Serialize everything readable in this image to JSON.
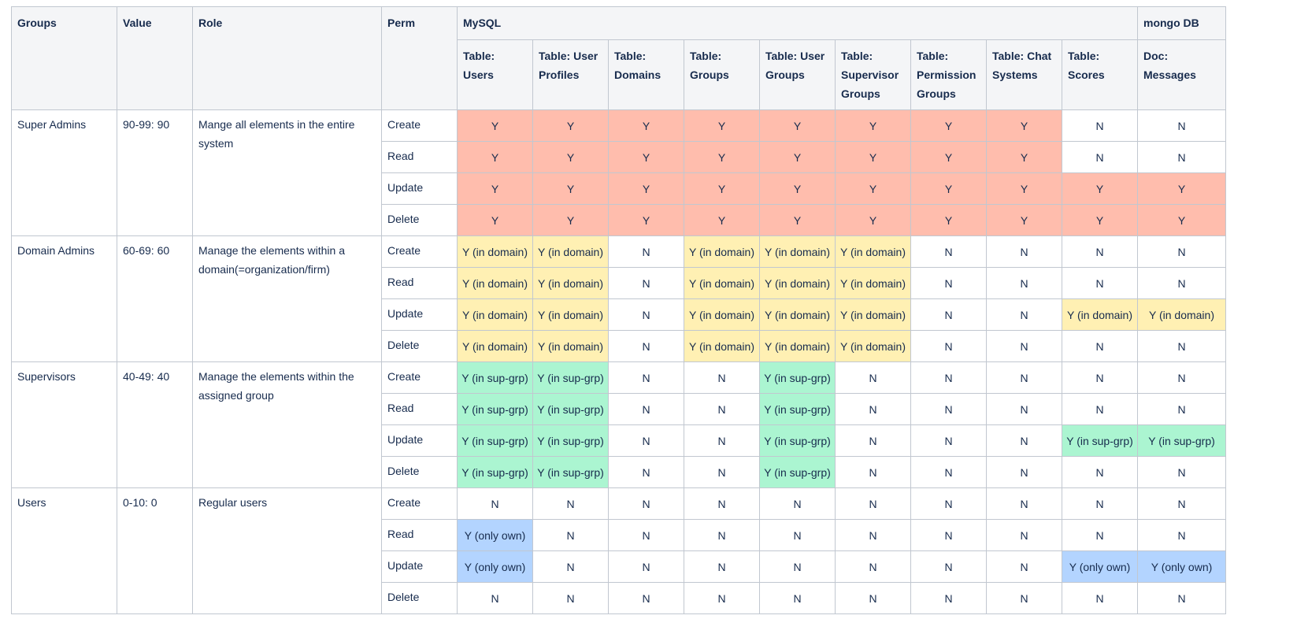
{
  "colors": {
    "red": "#ffbdad",
    "yellow": "#fff0b3",
    "green": "#abf5d1",
    "blue": "#b3d4ff",
    "none": "#ffffff"
  },
  "headers": {
    "groups": "Groups",
    "value": "Value",
    "role": "Role",
    "perm": "Perm",
    "mysql": "MySQL",
    "mongo": "mongo DB",
    "tables": [
      "Table: Users",
      "Table: User Profiles",
      "Table: Domains",
      "Table: Groups",
      "Table: User Groups",
      "Table: Supervisor Groups",
      "Table: Permission Groups",
      "Table: Chat Systems",
      "Table: Scores",
      "Doc: Messages"
    ]
  },
  "groups": [
    {
      "name": "Super Admins",
      "value": "90-99: 90",
      "role": "Mange all elements in the entire system",
      "rows": [
        {
          "perm": "Create",
          "cells": [
            "Y",
            "Y",
            "Y",
            "Y",
            "Y",
            "Y",
            "Y",
            "Y",
            "N",
            "N"
          ],
          "colors": [
            "red",
            "red",
            "red",
            "red",
            "red",
            "red",
            "red",
            "red",
            "none",
            "none"
          ]
        },
        {
          "perm": "Read",
          "cells": [
            "Y",
            "Y",
            "Y",
            "Y",
            "Y",
            "Y",
            "Y",
            "Y",
            "N",
            "N"
          ],
          "colors": [
            "red",
            "red",
            "red",
            "red",
            "red",
            "red",
            "red",
            "red",
            "none",
            "none"
          ]
        },
        {
          "perm": "Update",
          "cells": [
            "Y",
            "Y",
            "Y",
            "Y",
            "Y",
            "Y",
            "Y",
            "Y",
            "Y",
            "Y"
          ],
          "colors": [
            "red",
            "red",
            "red",
            "red",
            "red",
            "red",
            "red",
            "red",
            "red",
            "red"
          ]
        },
        {
          "perm": "Delete",
          "cells": [
            "Y",
            "Y",
            "Y",
            "Y",
            "Y",
            "Y",
            "Y",
            "Y",
            "Y",
            "Y"
          ],
          "colors": [
            "red",
            "red",
            "red",
            "red",
            "red",
            "red",
            "red",
            "red",
            "red",
            "red"
          ]
        }
      ]
    },
    {
      "name": "Domain Admins",
      "value": "60-69: 60",
      "role": "Manage the elements within a domain(=organization/firm)",
      "rows": [
        {
          "perm": "Create",
          "cells": [
            "Y (in domain)",
            "Y (in domain)",
            "N",
            "Y (in domain)",
            "Y (in domain)",
            "Y (in domain)",
            "N",
            "N",
            "N",
            "N"
          ],
          "colors": [
            "yellow",
            "yellow",
            "none",
            "yellow",
            "yellow",
            "yellow",
            "none",
            "none",
            "none",
            "none"
          ]
        },
        {
          "perm": "Read",
          "cells": [
            "Y (in domain)",
            "Y (in domain)",
            "N",
            "Y (in domain)",
            "Y (in domain)",
            "Y (in domain)",
            "N",
            "N",
            "N",
            "N"
          ],
          "colors": [
            "yellow",
            "yellow",
            "none",
            "yellow",
            "yellow",
            "yellow",
            "none",
            "none",
            "none",
            "none"
          ]
        },
        {
          "perm": "Update",
          "cells": [
            "Y (in domain)",
            "Y (in domain)",
            "N",
            "Y (in domain)",
            "Y (in domain)",
            "Y (in domain)",
            "N",
            "N",
            "Y (in domain)",
            "Y (in domain)"
          ],
          "colors": [
            "yellow",
            "yellow",
            "none",
            "yellow",
            "yellow",
            "yellow",
            "none",
            "none",
            "yellow",
            "yellow"
          ]
        },
        {
          "perm": "Delete",
          "cells": [
            "Y (in domain)",
            "Y (in domain)",
            "N",
            "Y (in domain)",
            "Y (in domain)",
            "Y (in domain)",
            "N",
            "N",
            "N",
            "N"
          ],
          "colors": [
            "yellow",
            "yellow",
            "none",
            "yellow",
            "yellow",
            "yellow",
            "none",
            "none",
            "none",
            "none"
          ]
        }
      ]
    },
    {
      "name": "Supervisors",
      "value": "40-49: 40",
      "role": "Manage the elements within the assigned group",
      "rows": [
        {
          "perm": "Create",
          "cells": [
            "Y (in sup-grp)",
            "Y (in sup-grp)",
            "N",
            "N",
            "Y (in sup-grp)",
            "N",
            "N",
            "N",
            "N",
            "N"
          ],
          "colors": [
            "green",
            "green",
            "none",
            "none",
            "green",
            "none",
            "none",
            "none",
            "none",
            "none"
          ]
        },
        {
          "perm": "Read",
          "cells": [
            "Y (in sup-grp)",
            "Y (in sup-grp)",
            "N",
            "N",
            "Y (in sup-grp)",
            "N",
            "N",
            "N",
            "N",
            "N"
          ],
          "colors": [
            "green",
            "green",
            "none",
            "none",
            "green",
            "none",
            "none",
            "none",
            "none",
            "none"
          ]
        },
        {
          "perm": "Update",
          "cells": [
            "Y (in sup-grp)",
            "Y (in sup-grp)",
            "N",
            "N",
            "Y (in sup-grp)",
            "N",
            "N",
            "N",
            "Y (in sup-grp)",
            "Y (in sup-grp)"
          ],
          "colors": [
            "green",
            "green",
            "none",
            "none",
            "green",
            "none",
            "none",
            "none",
            "green",
            "green"
          ]
        },
        {
          "perm": "Delete",
          "cells": [
            "Y (in sup-grp)",
            "Y (in sup-grp)",
            "N",
            "N",
            "Y (in sup-grp)",
            "N",
            "N",
            "N",
            "N",
            "N"
          ],
          "colors": [
            "green",
            "green",
            "none",
            "none",
            "green",
            "none",
            "none",
            "none",
            "none",
            "none"
          ]
        }
      ]
    },
    {
      "name": "Users",
      "value": "0-10: 0",
      "role": "Regular users",
      "rows": [
        {
          "perm": "Create",
          "cells": [
            "N",
            "N",
            "N",
            "N",
            "N",
            "N",
            "N",
            "N",
            "N",
            "N"
          ],
          "colors": [
            "none",
            "none",
            "none",
            "none",
            "none",
            "none",
            "none",
            "none",
            "none",
            "none"
          ]
        },
        {
          "perm": "Read",
          "cells": [
            "Y (only own)",
            "N",
            "N",
            "N",
            "N",
            "N",
            "N",
            "N",
            "N",
            "N"
          ],
          "colors": [
            "blue",
            "none",
            "none",
            "none",
            "none",
            "none",
            "none",
            "none",
            "none",
            "none"
          ]
        },
        {
          "perm": "Update",
          "cells": [
            "Y (only own)",
            "N",
            "N",
            "N",
            "N",
            "N",
            "N",
            "N",
            "Y (only own)",
            "Y (only own)"
          ],
          "colors": [
            "blue",
            "none",
            "none",
            "none",
            "none",
            "none",
            "none",
            "none",
            "blue",
            "blue"
          ]
        },
        {
          "perm": "Delete",
          "cells": [
            "N",
            "N",
            "N",
            "N",
            "N",
            "N",
            "N",
            "N",
            "N",
            "N"
          ],
          "colors": [
            "none",
            "none",
            "none",
            "none",
            "none",
            "none",
            "none",
            "none",
            "none",
            "none"
          ]
        }
      ]
    }
  ]
}
